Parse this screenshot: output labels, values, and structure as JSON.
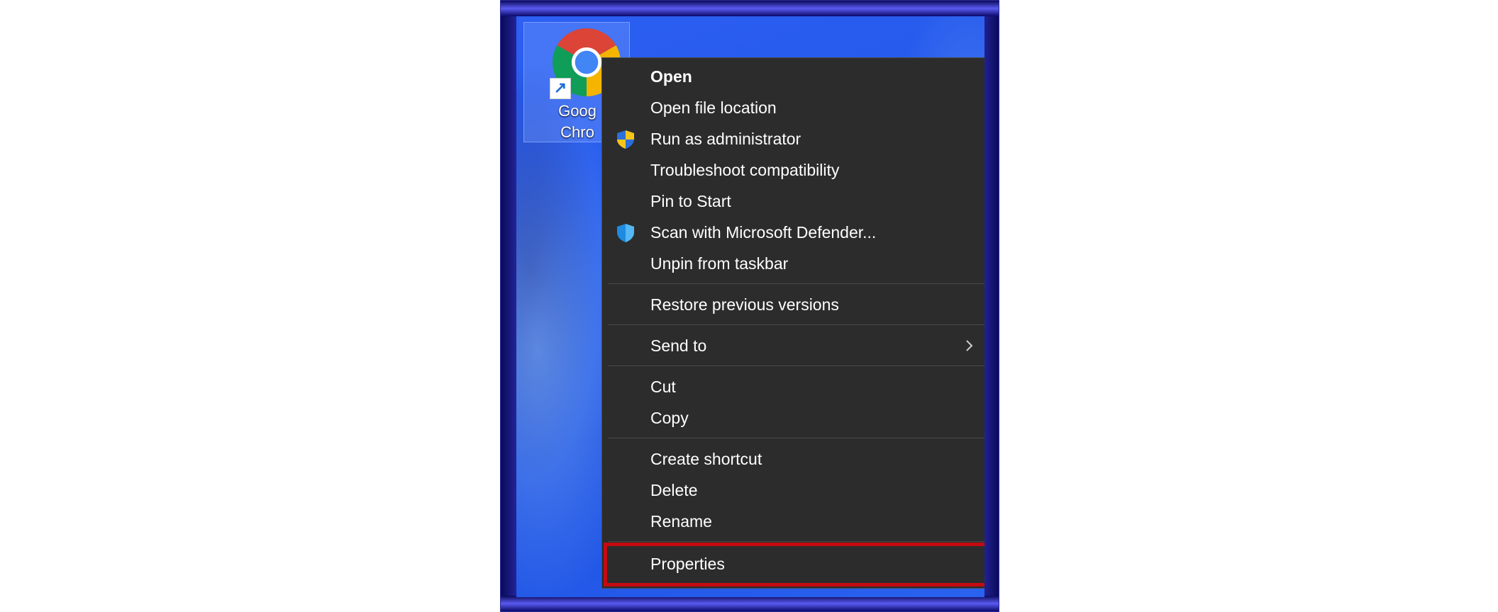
{
  "desktop": {
    "shortcut": {
      "label_line1": "Goog",
      "label_line2": "Chro",
      "icon": "chrome-icon",
      "badge_icon": "shortcut-arrow-icon"
    }
  },
  "context_menu": {
    "groups": [
      [
        {
          "label": "Open",
          "bold": true
        },
        {
          "label": "Open file location"
        },
        {
          "label": "Run as administrator",
          "icon": "uac-shield-icon"
        },
        {
          "label": "Troubleshoot compatibility"
        },
        {
          "label": "Pin to Start"
        },
        {
          "label": "Scan with Microsoft Defender...",
          "icon": "defender-shield-icon"
        },
        {
          "label": "Unpin from taskbar"
        }
      ],
      [
        {
          "label": "Restore previous versions"
        }
      ],
      [
        {
          "label": "Send to",
          "submenu_icon": "chevron-right-icon"
        }
      ],
      [
        {
          "label": "Cut"
        },
        {
          "label": "Copy"
        }
      ],
      [
        {
          "label": "Create shortcut"
        },
        {
          "label": "Delete"
        },
        {
          "label": "Rename"
        }
      ],
      [
        {
          "label": "Properties",
          "highlighted": true
        }
      ]
    ]
  },
  "colors": {
    "menu_background": "#2c2c2c",
    "menu_text": "#ffffff",
    "highlight_border": "#c40b12",
    "desktop_blue": "#2459ea"
  }
}
